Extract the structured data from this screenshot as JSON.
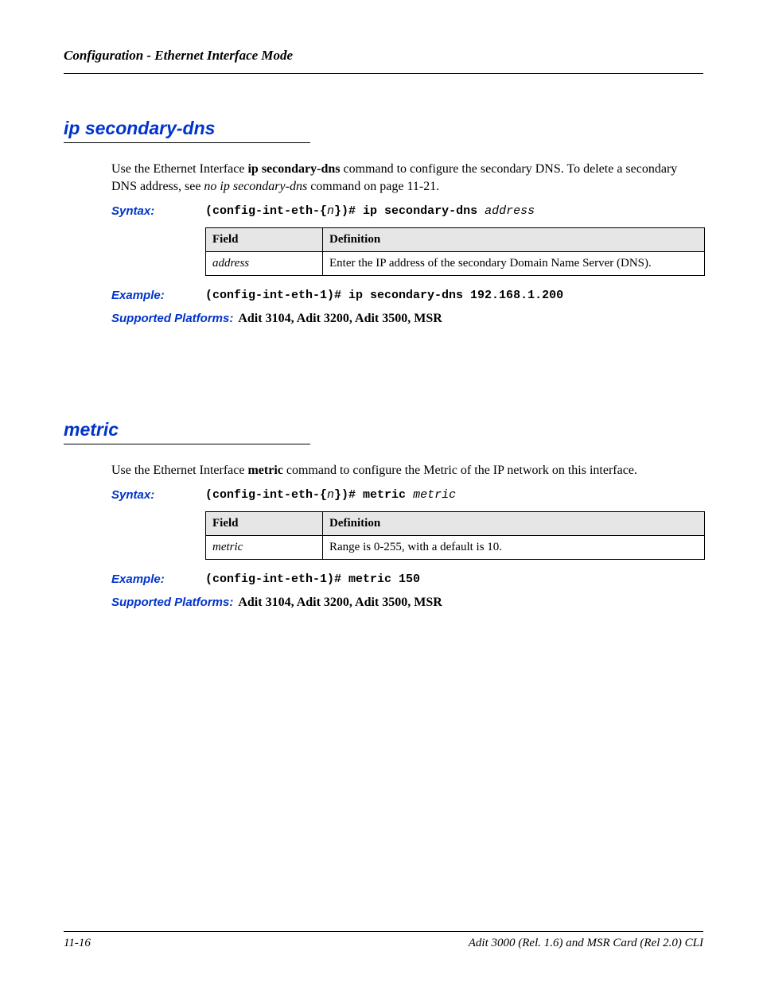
{
  "running_header": "Configuration - Ethernet Interface Mode",
  "labels": {
    "syntax": "Syntax:",
    "example": "Example:",
    "supported_platforms": "Supported Platforms:"
  },
  "table_headers": {
    "field": "Field",
    "definition": "Definition"
  },
  "sections": [
    {
      "title": "ip secondary-dns",
      "intro": {
        "prefix": "Use the Ethernet Interface ",
        "bold_cmd": "ip secondary-dns",
        "middle": " command to configure the secondary DNS. To delete a secondary DNS address, see ",
        "italic_ref": "no ip secondary-dns",
        "suffix": " command on page 11-21."
      },
      "syntax": {
        "prefix": "(config-int-eth-{",
        "n": "n",
        "mid": "})# ip secondary-dns ",
        "arg": "address"
      },
      "table": [
        {
          "field": "address",
          "definition": "Enter the IP address of the secondary Domain Name Server (DNS)."
        }
      ],
      "example": "(config-int-eth-1)# ip secondary-dns 192.168.1.200",
      "supported_platforms": "Adit 3104, Adit 3200, Adit 3500, MSR"
    },
    {
      "title": "metric",
      "intro": {
        "prefix": "Use the Ethernet Interface ",
        "bold_cmd": "metric",
        "middle": " command to configure the  Metric of the IP network on this interface.",
        "italic_ref": "",
        "suffix": ""
      },
      "syntax": {
        "prefix": "(config-int-eth-{",
        "n": "n",
        "mid": "})# metric ",
        "arg": "metric"
      },
      "table": [
        {
          "field": "metric",
          "definition": "Range is 0-255, with a default is 10."
        }
      ],
      "example": "(config-int-eth-1)# metric 150",
      "supported_platforms": "Adit 3104, Adit 3200, Adit 3500, MSR"
    }
  ],
  "footer": {
    "left": "11-16",
    "right": "Adit 3000 (Rel. 1.6) and MSR Card (Rel 2.0) CLI"
  }
}
